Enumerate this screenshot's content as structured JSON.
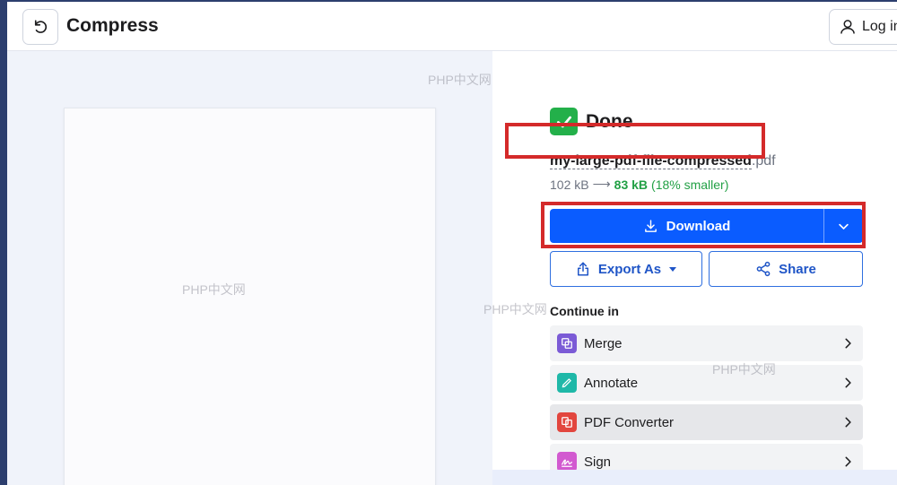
{
  "header": {
    "back_icon": "undo-icon",
    "title": "Compress",
    "login_icon": "user-icon",
    "login_label": "Log in"
  },
  "result": {
    "status_icon": "check-icon",
    "status": "Done",
    "file_base": "my-large-pdf-file-compressed",
    "file_ext": ".pdf",
    "size_original": "102 kB",
    "size_arrow": "⟶",
    "size_new": "83 kB",
    "size_reduction": "(18% smaller)"
  },
  "actions": {
    "download_icon": "download-icon",
    "download_label": "Download",
    "download_menu_icon": "chevron-down-icon",
    "export_icon": "export-icon",
    "export_label": "Export As",
    "share_icon": "share-icon",
    "share_label": "Share"
  },
  "continue": {
    "heading": "Continue in",
    "items": [
      {
        "label": "Merge",
        "icon": "merge-icon",
        "color": "#7b5bd6"
      },
      {
        "label": "Annotate",
        "icon": "pen-icon",
        "color": "#1fb8a8"
      },
      {
        "label": "PDF Converter",
        "icon": "convert-icon",
        "color": "#e2463e"
      },
      {
        "label": "Sign",
        "icon": "signature-icon",
        "color": "#d25ad0"
      }
    ]
  },
  "watermarks": [
    "PHP中文网",
    "PHP中文网",
    "PHP中文网",
    "PHP中文网"
  ],
  "colors": {
    "accent": "#0a5cff",
    "success": "#23b04a",
    "annotation_red": "#d42a2a"
  }
}
